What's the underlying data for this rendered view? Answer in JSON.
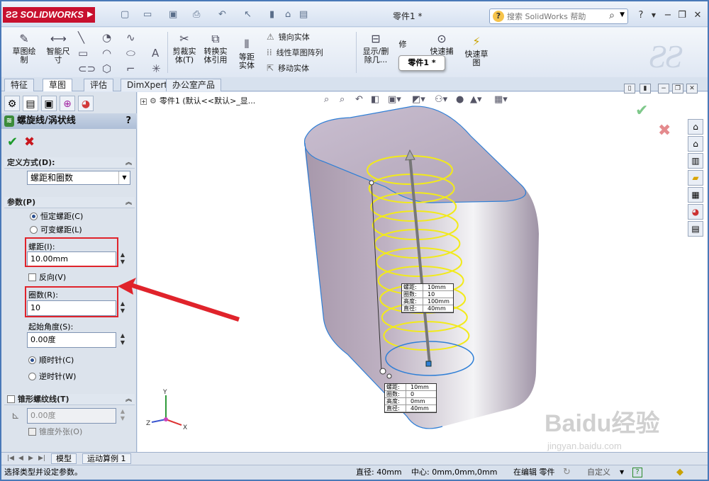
{
  "app": {
    "brand": "SOLIDWORKS",
    "doc_title": "零件1 *"
  },
  "search": {
    "placeholder": "搜索 SolidWorks 帮助"
  },
  "ribbon": {
    "sketch": "草图绘制",
    "smart_dim": "智能尺寸",
    "trim": "剪裁实体(T)",
    "convert": "转换实体引用",
    "offset": "等距实体",
    "mirror": "镜向实体",
    "linear_pattern": "线性草图阵列",
    "move": "移动实体",
    "show_delete": "显示/删除几...",
    "repair": "修",
    "quick_snap": "快速捕",
    "rapid_sketch": "快速草图",
    "tooltip": "零件1 *"
  },
  "tabs": [
    "特征",
    "草图",
    "评估",
    "DimXpert",
    "办公室产品"
  ],
  "panel": {
    "title": "螺旋线/涡状线",
    "help": "?",
    "define_section": "定义方式(D):",
    "define_value": "螺距和圈数",
    "params_section": "参数(P)",
    "const_pitch": "恒定螺距(C)",
    "var_pitch": "可变螺距(L)",
    "pitch_label": "螺距(I):",
    "pitch_value": "10.00mm",
    "reverse": "反向(V)",
    "rev_label": "圈数(R):",
    "rev_value": "10",
    "start_angle_label": "起始角度(S):",
    "start_angle_value": "0.00度",
    "cw": "顺时针(C)",
    "ccw": "逆时针(W)",
    "taper_section": "锥形螺纹线(T)",
    "taper_value": "0.00度",
    "taper_out": "锥度外张(O)"
  },
  "tree": {
    "item": "零件1 (默认<<默认>_显..."
  },
  "callout_top": {
    "rows": [
      [
        "螺距:",
        "10mm"
      ],
      [
        "圈数:",
        "10"
      ],
      [
        "高度:",
        "100mm"
      ],
      [
        "直径:",
        "40mm"
      ]
    ]
  },
  "callout_bottom": {
    "rows": [
      [
        "螺距:",
        "10mm"
      ],
      [
        "圈数:",
        "0"
      ],
      [
        "高度:",
        "0mm"
      ],
      [
        "直径:",
        "40mm"
      ]
    ]
  },
  "bottom_tabs": [
    "模型",
    "运动算例 1"
  ],
  "status": {
    "left": "选择类型并设定参数。",
    "diameter": "直径: 40mm",
    "center": "中心: 0mm,0mm,0mm",
    "editing": "在编辑 零件",
    "custom": "自定义"
  },
  "triad": {
    "x": "X",
    "y": "Y",
    "z": "Z"
  },
  "watermark": {
    "brand": "Baidu经验",
    "url": "jingyan.baidu.com"
  },
  "colors": {
    "helix": "#f2ea1a",
    "body": "#b9a9bd",
    "edge": "#2f7fd6",
    "highlight": "#e0232b"
  }
}
